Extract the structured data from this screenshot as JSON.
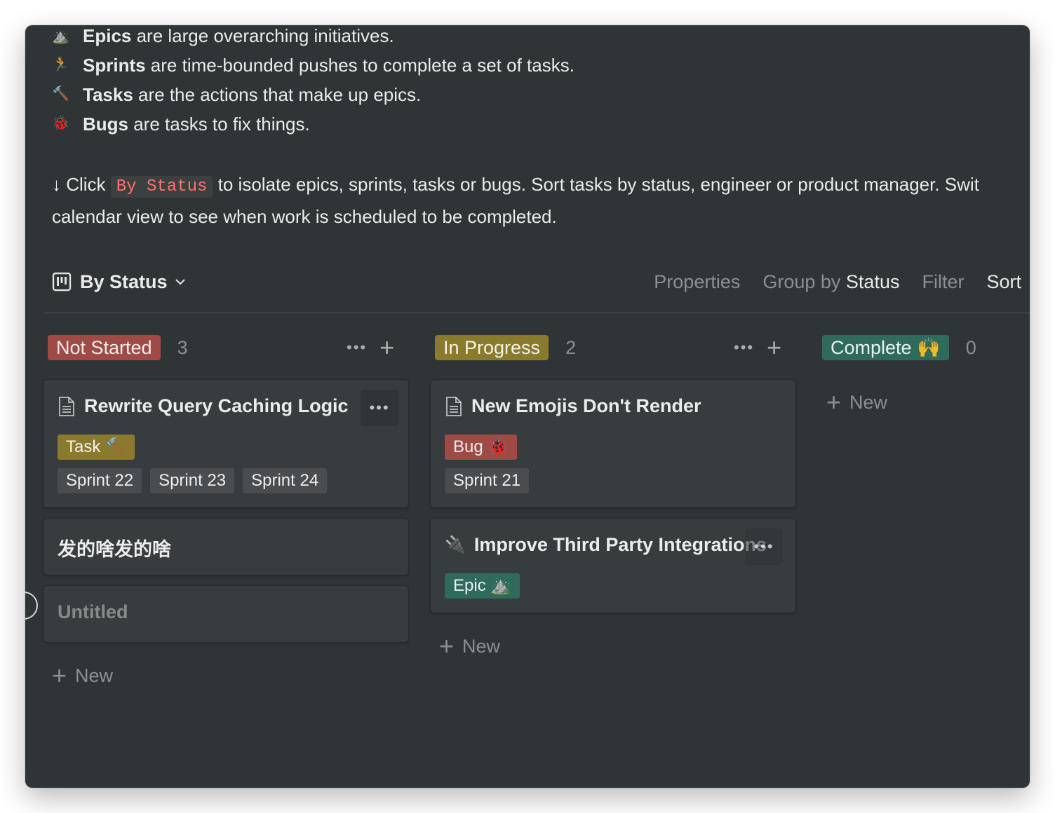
{
  "intro": {
    "lines": [
      {
        "icon": "⛰️",
        "bold": "Epics",
        "rest": " are large overarching initiatives."
      },
      {
        "icon": "🏃",
        "bold": "Sprints",
        "rest": " are time-bounded pushes to complete a set of tasks."
      },
      {
        "icon": "🔨",
        "bold": "Tasks",
        "rest": " are the actions that make up epics."
      },
      {
        "icon": "🐞",
        "bold": "Bugs",
        "rest": " are tasks to fix things."
      }
    ],
    "click_prefix": "↓ Click ",
    "click_code": "By Status",
    "click_suffix": " to isolate epics, sprints, tasks or bugs. Sort tasks by status, engineer or product manager. Swit",
    "click_line2": "calendar view to see when work is scheduled to be completed."
  },
  "view": {
    "icon": "board-icon",
    "title": "By Status",
    "actions": {
      "properties": "Properties",
      "group_by_prefix": "Group by",
      "group_by_value": "Status",
      "filter": "Filter",
      "sort": "Sort"
    }
  },
  "columns": [
    {
      "status": "Not Started",
      "count": "3",
      "color": "#a04a46",
      "cards": [
        {
          "title": "Rewrite Query Caching Logic",
          "type_tag": "Task 🔨",
          "type_color": "#8b7a2e",
          "sprints": [
            "Sprint 22",
            "Sprint 23",
            "Sprint 24"
          ]
        },
        {
          "title": "发的啥发的啥"
        },
        {
          "title": "Untitled"
        }
      ],
      "new_label": "New"
    },
    {
      "status": "In Progress",
      "count": "2",
      "color": "#8a7a2c",
      "cards": [
        {
          "title": "New Emojis Don't Render",
          "type_tag": "Bug 🐞",
          "type_color": "#a04a46",
          "sprints": [
            "Sprint 21"
          ]
        },
        {
          "title": "Improve Third Party Integrations",
          "title_icon": "🔌",
          "type_tag": "Epic ⛰️",
          "type_color": "#2f6b5c"
        }
      ],
      "new_label": "New"
    },
    {
      "status": "Complete 🙌",
      "count": "0",
      "color": "#2f6b5c",
      "cards": [],
      "new_label": "New"
    }
  ]
}
